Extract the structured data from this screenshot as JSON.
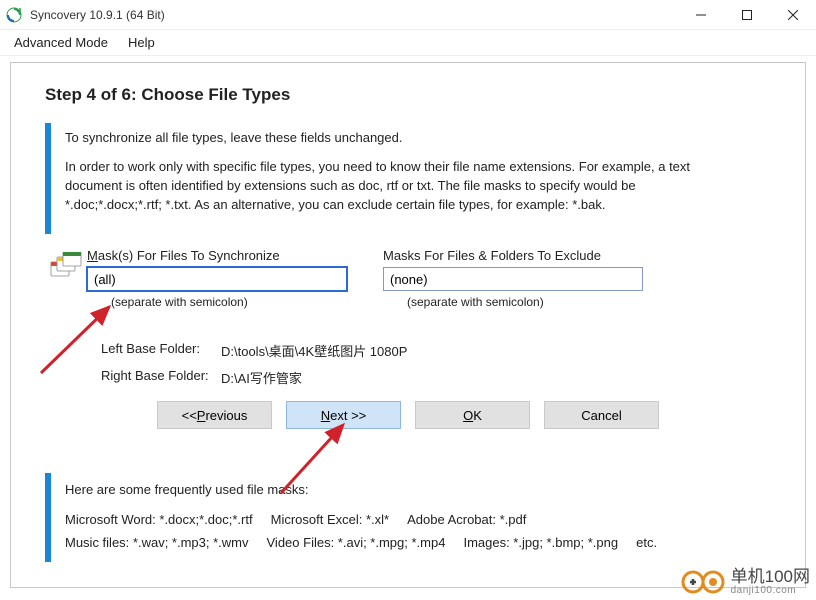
{
  "window": {
    "title": "Syncovery 10.9.1 (64 Bit)"
  },
  "menu": {
    "advanced": "Advanced Mode",
    "help": "Help"
  },
  "heading": "Step 4 of 6: Choose File Types",
  "intro": {
    "p1": "To synchronize all file types, leave these fields unchanged.",
    "p2": "In order to work only with specific file types, you need to know their file name extensions. For example, a text document is often identified by extensions such as doc, rtf or txt. The file masks to specify would be *.doc;*.docx;*.rtf; *.txt. As an alternative, you can exclude certain file types, for example: *.bak."
  },
  "masks": {
    "sync_label_pre": "M",
    "sync_label_rest": "ask(s) For Files To Synchronize",
    "sync_value": "(all)",
    "sync_hint": "(separate with semicolon)",
    "excl_label": "Masks For Files & Folders To Exclude",
    "excl_value": "(none)",
    "excl_hint": "(separate with semicolon)"
  },
  "folders": {
    "left_label": "Left Base Folder:",
    "left_value": "D:\\tools\\桌面\\4K壁纸图片 1080P",
    "right_label": "Right Base Folder:",
    "right_value": "D:\\AI写作管家"
  },
  "buttons": {
    "prev_pre": "<< ",
    "prev_u": "P",
    "prev_rest": "revious",
    "next_u": "N",
    "next_rest": "ext >>",
    "ok_u": "O",
    "ok_rest": "K",
    "cancel": "Cancel"
  },
  "footer": {
    "heading": "Here are some frequently used file masks:",
    "ex1": "Microsoft Word: *.docx;*.doc;*.rtf",
    "ex2": "Microsoft Excel: *.xl*",
    "ex3": "Adobe Acrobat: *.pdf",
    "ex4": "Music files: *.wav; *.mp3; *.wmv",
    "ex5": "Video Files: *.avi; *.mpg; *.mp4",
    "ex6": "Images: *.jpg; *.bmp; *.png",
    "ex7": "etc."
  },
  "watermark": {
    "name": "单机100网",
    "url": "danji100.com"
  }
}
